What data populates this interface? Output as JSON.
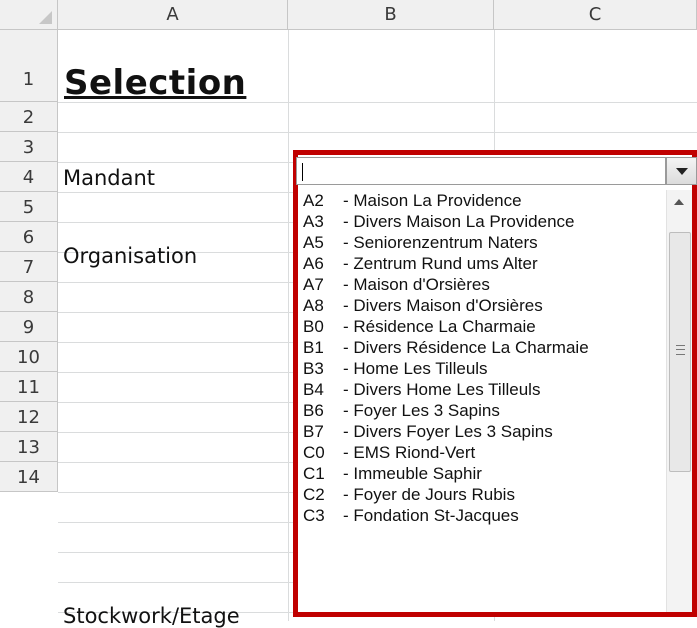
{
  "columns": [
    "A",
    "B",
    "C"
  ],
  "rows": [
    "1",
    "2",
    "3",
    "4",
    "5",
    "6",
    "7",
    "8",
    "9",
    "10",
    "11",
    "12",
    "13",
    "14"
  ],
  "cells": {
    "a1": "Selection",
    "a3": "Mandant",
    "a5": "Organisation",
    "a14": "Stockwork/Etage"
  },
  "combo": {
    "value": "",
    "items": [
      {
        "code": "A2",
        "label": "- Maison La Providence"
      },
      {
        "code": "A3",
        "label": "- Divers Maison La Providence"
      },
      {
        "code": "A5",
        "label": "- Seniorenzentrum Naters"
      },
      {
        "code": "A6",
        "label": "- Zentrum Rund ums Alter"
      },
      {
        "code": "A7",
        "label": "- Maison d'Orsières"
      },
      {
        "code": "A8",
        "label": "- Divers Maison d'Orsières"
      },
      {
        "code": "B0",
        "label": "- Résidence La Charmaie"
      },
      {
        "code": "B1",
        "label": "- Divers Résidence La Charmaie"
      },
      {
        "code": "B3",
        "label": "- Home Les Tilleuls"
      },
      {
        "code": "B4",
        "label": "- Divers Home Les Tilleuls"
      },
      {
        "code": "B6",
        "label": "- Foyer Les 3 Sapins"
      },
      {
        "code": "B7",
        "label": "- Divers Foyer Les 3 Sapins"
      },
      {
        "code": "C0",
        "label": "- EMS Riond-Vert"
      },
      {
        "code": "C1",
        "label": "- Immeuble Saphir"
      },
      {
        "code": "C2",
        "label": "- Foyer de Jours Rubis"
      },
      {
        "code": "C3",
        "label": "- Fondation St-Jacques"
      }
    ]
  },
  "colors": {
    "highlight_frame": "#c00000",
    "header_bg": "#f0f0f0",
    "grid": "#dadcdd"
  },
  "icons": [
    "dropdown-arrow-icon",
    "scroll-up-icon",
    "scroll-grip-icon",
    "select-all-triangle-icon"
  ]
}
